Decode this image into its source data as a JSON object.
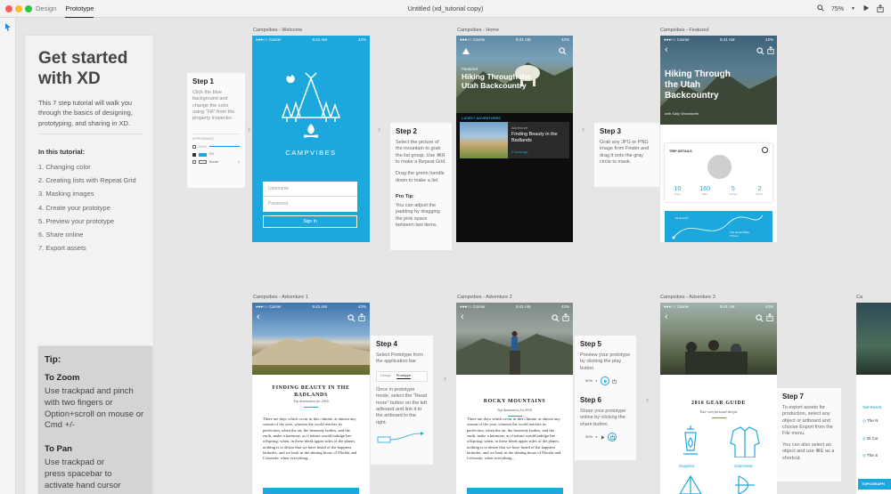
{
  "window": {
    "title": "Untitled (xd_tutorial copy)",
    "tabs": [
      "Design",
      "Prototype"
    ],
    "zoom": "75%"
  },
  "intro": {
    "title": "Get started with XD",
    "description": "This 7 step tutorial will walk you through the basics of designing, prototyping, and sharing in XD.",
    "subtitle": "In this tutorial:",
    "items": [
      "1. Changing color",
      "2. Creating lists with Repeat Grid",
      "3. Masking images",
      "4. Create your prototype",
      "5. Preview your prototype",
      "6. Share online",
      "7. Export assets"
    ]
  },
  "tip": {
    "title": "Tip:",
    "zoom_title": "To Zoom",
    "zoom_text": "Use trackpad and pinch with two fingers or Option+scroll on mouse or Cmd +/-",
    "pan_title": "To Pan",
    "pan_text": "Use trackpad or press spacebar to activate hand cursor"
  },
  "artboard_labels": {
    "welcome": "Campvibes - Welcome",
    "home": "Campvibes - Home",
    "featured": "Campvibes - Featured",
    "adv1": "Campvibes - Adventure 1",
    "adv2": "Campvibes - Adventure 2",
    "adv3": "Campvibes - Adventure 3"
  },
  "status": {
    "carrier": "●●●○○ Carrier",
    "time": "9:41 AM",
    "battery": "42%"
  },
  "step1": {
    "title": "Step 1",
    "text": "Click the blue background and change the color using \"Fill\" from the property inspector.",
    "panel_header": "APPEARANCE",
    "opacity": "100%",
    "fill": "Fill",
    "border": "Border",
    "border_val": "1"
  },
  "welcome": {
    "app_name": "CAMPVIBES",
    "username": "Username",
    "password": "Password",
    "signin": "Sign In"
  },
  "step2": {
    "title": "Step 2",
    "text": "Select the picture of the mountain to grab the list group. Use ⌘R to make a Repeat Grid.",
    "text2": "Drag the green handle down to make a list.",
    "protip_title": "Pro Tip:",
    "protip": "You can adjust the padding by dragging the pink space between two items."
  },
  "home": {
    "label": "Featured",
    "headline": "Hiking Through the Utah Backcountry",
    "section": "LATEST ADVENTURES",
    "card_kicker": "Adventure",
    "card_title": "Finding Beauty in the Badlands",
    "card_time": "2 hours ago"
  },
  "step3": {
    "title": "Step 3",
    "text": "Grab any JPG or PNG image from Finder and drag it onto the gray circle to mask."
  },
  "featured": {
    "headline": "Hiking Through the Utah Backcountry",
    "byline": "with Sally Woodworth",
    "details": "TRIP DETAILS",
    "stats": [
      {
        "value": "10",
        "label": "Days"
      },
      {
        "value": "160",
        "label": "Miles"
      },
      {
        "value": "5",
        "label": "Camps"
      },
      {
        "value": "2",
        "label": "Bears"
      }
    ],
    "map_a": "Mt Smooth",
    "map_b": "The Great White Throne"
  },
  "adv1": {
    "title": "FINDING BEAUTY IN THE BADLANDS",
    "subtitle": "Top destination for 2016",
    "body": "There are days which occur in this climate, at almost any season of the year, wherein the world reaches its perfection, when the air, the heavenly bodies, and the earth, make a harmony, as if nature would indulge her offspring; when, in these bleak upper sides of the planet, nothing is to desire that we have heard of the happiest latitudes, and we bask in the shining hours of Florida and Colorado; when everything..."
  },
  "step4": {
    "title": "Step 4",
    "text": "Select Prototype from the application bar.",
    "tab_design": "Design",
    "tab_prototype": "Prototype",
    "text2": "Once in prototype mode, select the \"Read more\" button on the left artboard and link it to the artboard to the right."
  },
  "adv2": {
    "title": "ROCKY MOUNTAINS",
    "subtitle": "Top destination for 2016",
    "body": "There are days which occur in this climate, at almost any season of the year, wherein the world reaches its perfection, when the air, the heavenly bodies, and the earth, make a harmony, as if nature would indulge her offspring; when, in these bleak upper sides of the planet, nothing is to desire that we have heard of the happiest latitudes, and we bask in the shining hours of Florida and Colorado; when everything..."
  },
  "step5": {
    "title": "Step 5",
    "text": "Preview your prototype by clicking the play button.",
    "zoom": "50%"
  },
  "step6": {
    "title": "Step 6",
    "text": "Share your prototype online by clicking the share button.",
    "zoom": "50%"
  },
  "adv3": {
    "title": "2016 GEAR GUIDE",
    "subtitle": "Your own personal sherpa",
    "items": [
      "Supplies",
      "Outerwear"
    ]
  },
  "step7": {
    "title": "Step 7",
    "text": "To export assets for production, select any object or artboard and choose Export from the File menu.",
    "text2": "You can also select an object and use ⌘E as a shortcut."
  },
  "partial": {
    "header": "TOP POSTS",
    "items": [
      "The N",
      "El Cor",
      "The S"
    ],
    "footer": "TOPOGRAPH"
  }
}
